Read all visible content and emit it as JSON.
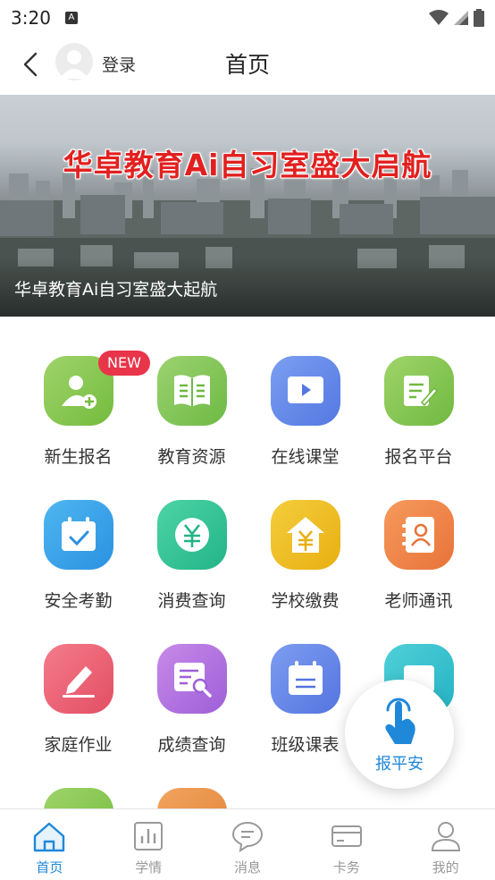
{
  "status": {
    "time": "3:20",
    "notify_glyph": "A"
  },
  "header": {
    "login_label": "登录",
    "title": "首页"
  },
  "banner": {
    "headline": "华卓教育Ai自习室盛大启航",
    "caption": "华卓教育Ai自习室盛大起航"
  },
  "features": [
    {
      "label": "新生报名",
      "icon": "new-student-icon",
      "badge": "NEW"
    },
    {
      "label": "教育资源",
      "icon": "book-icon"
    },
    {
      "label": "在线课堂",
      "icon": "video-play-icon"
    },
    {
      "label": "报名平台",
      "icon": "edit-document-icon"
    },
    {
      "label": "安全考勤",
      "icon": "calendar-check-icon"
    },
    {
      "label": "消费查询",
      "icon": "yuan-coin-icon"
    },
    {
      "label": "学校缴费",
      "icon": "school-fee-icon"
    },
    {
      "label": "老师通讯",
      "icon": "contacts-book-icon"
    },
    {
      "label": "家庭作业",
      "icon": "pencil-icon"
    },
    {
      "label": "成绩查询",
      "icon": "score-search-icon"
    },
    {
      "label": "班级课表",
      "icon": "schedule-icon"
    },
    {
      "label": "",
      "icon": "partial-tile-icon"
    }
  ],
  "float_button": {
    "label": "报平安",
    "icon": "tap-hand-icon"
  },
  "tabbar": [
    {
      "label": "首页",
      "icon": "home-icon",
      "active": true
    },
    {
      "label": "学情",
      "icon": "bar-chart-icon"
    },
    {
      "label": "消息",
      "icon": "message-icon"
    },
    {
      "label": "卡务",
      "icon": "card-icon"
    },
    {
      "label": "我的",
      "icon": "user-icon"
    }
  ],
  "colors": {
    "accent": "#2088d8",
    "badge": "#e8354a",
    "headline": "#e2201f"
  }
}
